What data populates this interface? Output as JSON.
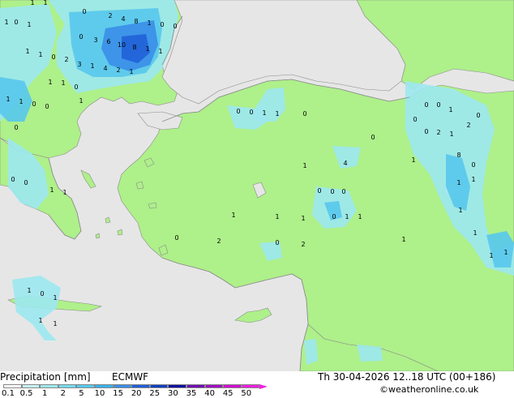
{
  "map": {
    "colors": {
      "sea": "#e6e6e6",
      "land": "#aef08a",
      "coast": "#8a8a8a",
      "precip_light": "#9ce8f0",
      "precip_mid": "#58c8ec",
      "precip_heavy": "#3a8ee8",
      "precip_max": "#2060d8"
    },
    "values": [
      "1",
      "1",
      "0",
      "0",
      "1",
      "2",
      "4",
      "8",
      "1",
      "0",
      "0",
      "1",
      "0",
      "3",
      "6",
      "10",
      "8",
      "1",
      "1",
      "3",
      "1",
      "4",
      "2",
      "1",
      "1",
      "1",
      "0",
      "2",
      "1",
      "1",
      "0",
      "1",
      "1",
      "0",
      "0",
      "1",
      "0",
      "0",
      "0",
      "1",
      "1",
      "0",
      "0",
      "1",
      "1",
      "0",
      "0",
      "4",
      "1",
      "0",
      "0",
      "0",
      "1",
      "2",
      "0",
      "0",
      "2",
      "1",
      "1",
      "8",
      "0",
      "1",
      "1",
      "0",
      "0",
      "0",
      "1",
      "1",
      "1",
      "0",
      "1",
      "1",
      "0",
      "2",
      "0",
      "2",
      "1",
      "1",
      "1",
      "1",
      "1",
      "1",
      "0",
      "1",
      "1",
      "1"
    ]
  },
  "footer": {
    "title": "Precipitation [mm]",
    "model": "ECMWF",
    "datetime": "Th 30-04-2026 12..18 UTC (00+186)",
    "copyright": "©weatheronline.co.uk",
    "scale_labels": [
      "0.1",
      "0.5",
      "1",
      "2",
      "5",
      "10",
      "15",
      "20",
      "25",
      "30",
      "35",
      "40",
      "45",
      "50"
    ],
    "scale_colors": [
      "#ffffff",
      "#c8f5f8",
      "#9ce8f0",
      "#74dcf0",
      "#58c8ec",
      "#3ab0e8",
      "#3a8ee8",
      "#2060d8",
      "#1040c0",
      "#1010a0",
      "#7010b0",
      "#a010c0",
      "#d010d0",
      "#f020e0"
    ]
  }
}
